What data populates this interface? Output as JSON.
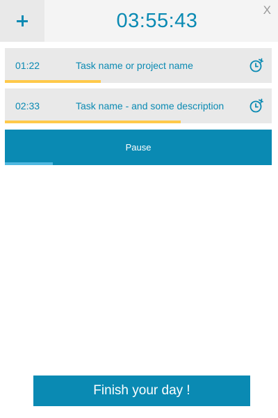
{
  "header": {
    "add_icon": "plus-icon",
    "timer": "03:55:43",
    "close_label": "X"
  },
  "tasks": [
    {
      "time": "01:22",
      "name": "Task name or project name",
      "icon": "alarm-clock-icon",
      "progress": 0.36
    },
    {
      "time": "02:33",
      "name": "Task name - and some description",
      "icon": "alarm-clock-icon",
      "progress": 0.66
    }
  ],
  "pause": {
    "label": "Pause",
    "progress": 0.18
  },
  "finish": {
    "label": "Finish your day !"
  },
  "colors": {
    "accent": "#0a8ab3",
    "progress_yellow": "#ffc94a",
    "pause_progress": "#4fb8e0",
    "task_bg": "#e9e9e9",
    "header_bg": "#f4f4f4",
    "close": "#999999"
  }
}
